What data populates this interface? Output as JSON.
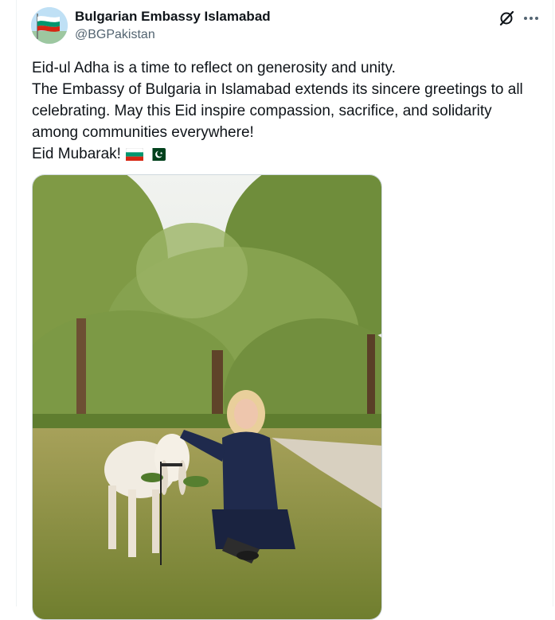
{
  "post": {
    "author_name": "Bulgarian Embassy Islamabad",
    "author_handle": "@BGPakistan",
    "text_lines": [
      "Eid-ul Adha is a time to reflect on generosity and unity.",
      "The Embassy of Bulgaria in Islamabad extends its sincere greetings to all",
      "celebrating. May this Eid inspire compassion, sacrifice, and solidarity",
      "among communities everywhere!",
      "Eid Mubarak!"
    ],
    "inline_emoji": [
      "bulgaria-flag",
      "pakistan-flag"
    ]
  },
  "actions": {
    "grok_icon": "grok-icon",
    "more_icon": "more-icon"
  },
  "colors": {
    "text": "#0f1419",
    "secondary": "#536471",
    "border": "#cfd9de",
    "bulgaria_white": "#ffffff",
    "bulgaria_green": "#00966e",
    "bulgaria_red": "#d62612",
    "pakistan_green": "#01411c"
  }
}
